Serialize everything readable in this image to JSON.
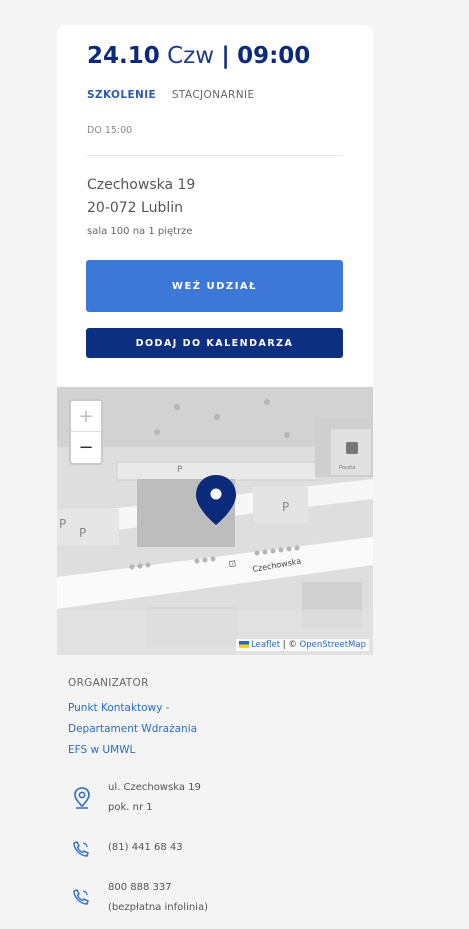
{
  "event": {
    "date": "24.10",
    "day": "Czw",
    "separator": "|",
    "time": "09:00",
    "tag_type": "SZKOLENIE",
    "tag_mode": "STACJONARNIE",
    "until": "DO 15:00",
    "address_line1": "Czechowska 19",
    "address_line2": "20-072 Lublin",
    "room": "sala 100 na 1 piętrze",
    "join_label": "WEŹ UDZIAŁ",
    "calendar_label": "DODAJ DO KALENDARZA"
  },
  "map": {
    "zoom_in": "+",
    "zoom_out": "−",
    "street_label": "Czechowska",
    "parking_label": "P",
    "shop_label": "Poczta",
    "attribution_leaflet": "Leaflet",
    "attribution_sep": " | © ",
    "attribution_osm": "OpenStreetMap",
    "marker_color": "#0b2a7a"
  },
  "organizer": {
    "label": "ORGANIZATOR",
    "name_lines": [
      "Punkt Kontaktowy -",
      "Departament Wdrażania",
      "EFS w UMWL"
    ],
    "address_line1": "ul. Czechowska 19",
    "address_line2": "pok. nr 1",
    "phone": "(81) 441 68 43",
    "hotline_line1": "800 888 337",
    "hotline_line2": "(bezpłatna infolinia)"
  },
  "icons": {
    "location": "location-pin-icon",
    "phone": "phone-icon"
  },
  "colors": {
    "title": "#0b2a7a",
    "primary_button": "#3d78d8",
    "secondary_button": "#0d2f80",
    "link": "#2a6cc5"
  }
}
